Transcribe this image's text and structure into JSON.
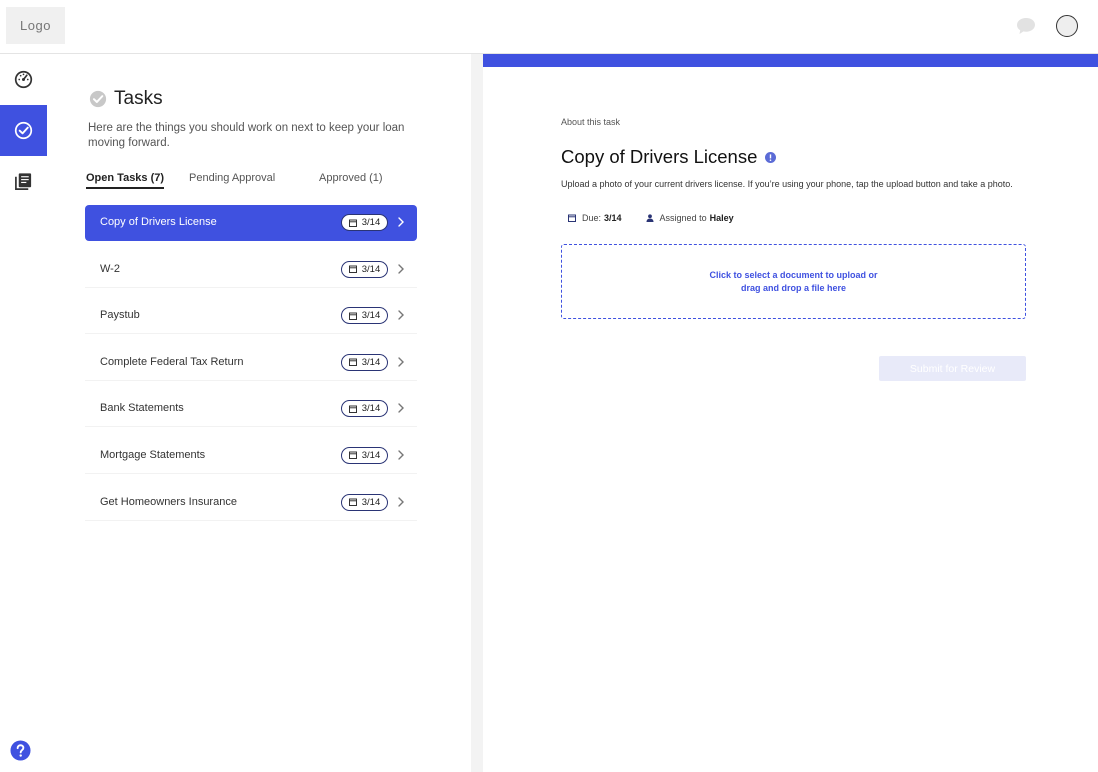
{
  "header": {
    "logo_text": "Logo",
    "chat_icon": "chat-bubble-icon",
    "avatar_icon": "user-avatar"
  },
  "rail": {
    "items": [
      {
        "icon": "dashboard-gauge-icon",
        "active": false
      },
      {
        "icon": "tasks-check-icon",
        "active": true
      },
      {
        "icon": "documents-icon",
        "active": false
      }
    ],
    "help_icon": "help-question-icon"
  },
  "tasks": {
    "title": "Tasks",
    "description": "Here are the things you should work on next to keep your loan moving forward.",
    "tabs": [
      {
        "label": "Open Tasks (7)",
        "active": true
      },
      {
        "label": "Pending Approval",
        "active": false
      },
      {
        "label": "Approved (1)",
        "active": false
      }
    ],
    "items": [
      {
        "label": "Copy of Drivers License",
        "due": "3/14",
        "active": true
      },
      {
        "label": "W-2",
        "due": "3/14",
        "active": false
      },
      {
        "label": "Paystub",
        "due": "3/14",
        "active": false
      },
      {
        "label": "Complete Federal Tax Return",
        "due": "3/14",
        "active": false
      },
      {
        "label": "Bank Statements",
        "due": "3/14",
        "active": false
      },
      {
        "label": "Mortgage Statements",
        "due": "3/14",
        "active": false
      },
      {
        "label": "Get Homeowners Insurance",
        "due": "3/14",
        "active": false
      }
    ]
  },
  "detail": {
    "about_label": "About this task",
    "title": "Copy of Drivers License",
    "description": "Upload a photo of your current drivers license. If you’re using your phone, tap the upload button and take a photo.",
    "due_label": "Due:",
    "due_value": "3/14",
    "assigned_label": "Assigned to",
    "assigned_value": "Haley",
    "dropzone_line1": "Click to select a document to upload or",
    "dropzone_line2": "drag and drop a file here",
    "submit_label": "Submit for Review"
  },
  "colors": {
    "accent": "#3f51e0",
    "submit_disabled_bg": "#e8eaf9"
  }
}
